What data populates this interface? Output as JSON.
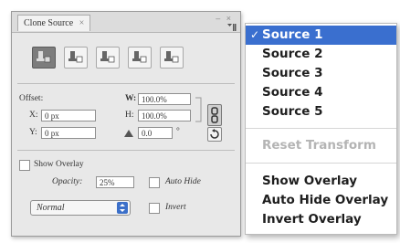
{
  "panel": {
    "tab_label": "Clone Source",
    "tab_close": "×",
    "window_controls": "– ×",
    "source_buttons": [
      "Source 1",
      "Source 2",
      "Source 3",
      "Source 4",
      "Source 5"
    ],
    "offset_label": "Offset:",
    "x_label": "X:",
    "x_value": "0 px",
    "y_label": "Y:",
    "y_value": "0 px",
    "w_label": "W:",
    "w_value": "100.0%",
    "h_label": "H:",
    "h_value": "100.0%",
    "angle_value": "0.0",
    "angle_unit": "°",
    "show_overlay_label": "Show Overlay",
    "opacity_label": "Opacity:",
    "opacity_value": "25%",
    "auto_hide_label": "Auto Hide",
    "blend_mode": "Normal",
    "invert_label": "Invert"
  },
  "menu": {
    "items": [
      {
        "label": "Source 1",
        "checked": true
      },
      {
        "label": "Source 2"
      },
      {
        "label": "Source 3"
      },
      {
        "label": "Source 4"
      },
      {
        "label": "Source 5"
      }
    ],
    "reset_transform": "Reset Transform",
    "overlay_items": [
      "Show Overlay",
      "Auto Hide Overlay",
      "Invert Overlay"
    ],
    "check_mark": "✓"
  },
  "colors": {
    "highlight": "#3a6fcf",
    "panel_bg": "#e8e8e8"
  }
}
